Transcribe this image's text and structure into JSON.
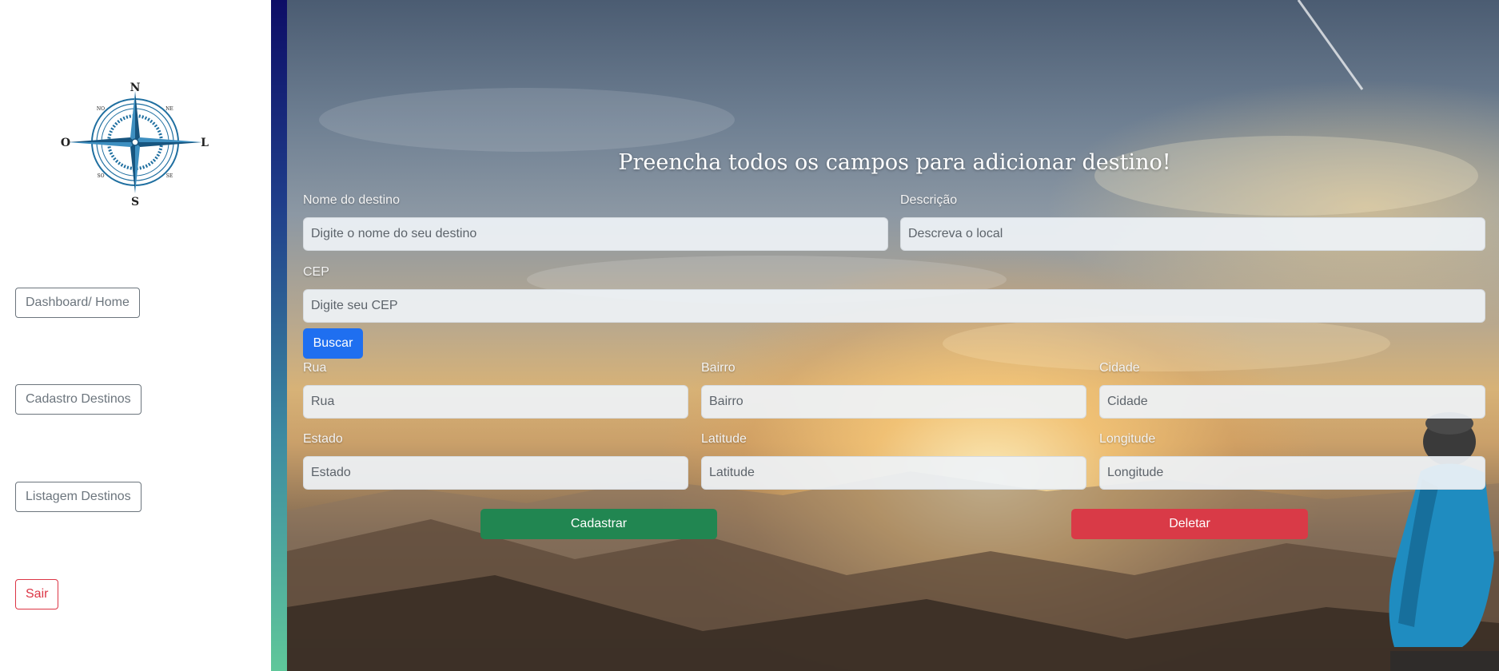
{
  "sidebar": {
    "logo": {
      "icon": "compass-rose-icon",
      "north": "N",
      "south": "S",
      "east": "L",
      "west": "O",
      "ne": "NE",
      "no": "NO",
      "se": "SE",
      "so": "SO"
    },
    "nav": {
      "dashboard": "Dashboard/ Home",
      "cadastro": "Cadastro Destinos",
      "listagem": "Listagem Destinos",
      "sair": "Sair"
    }
  },
  "form": {
    "title": "Preencha todos os campos para adicionar destino!",
    "nome": {
      "label": "Nome do destino",
      "placeholder": "Digite o nome do seu destino",
      "value": ""
    },
    "descricao": {
      "label": "Descrição",
      "placeholder": "Descreva o local",
      "value": ""
    },
    "cep": {
      "label": "CEP",
      "placeholder": "Digite seu CEP",
      "value": ""
    },
    "buscar_label": "Buscar",
    "rua": {
      "label": "Rua",
      "placeholder": "Rua",
      "value": ""
    },
    "bairro": {
      "label": "Bairro",
      "placeholder": "Bairro",
      "value": ""
    },
    "cidade": {
      "label": "Cidade",
      "placeholder": "Cidade",
      "value": ""
    },
    "estado": {
      "label": "Estado",
      "placeholder": "Estado",
      "value": ""
    },
    "latitude": {
      "label": "Latitude",
      "placeholder": "Latitude",
      "value": ""
    },
    "longitude": {
      "label": "Longitude",
      "placeholder": "Longitude",
      "value": ""
    },
    "cadastrar_label": "Cadastrar",
    "deletar_label": "Deletar"
  },
  "colors": {
    "primary": "#1f6ff0",
    "success": "#218651",
    "danger": "#d93a47",
    "sidebar_button": "#6c757d",
    "compass": "#1f6fa0"
  }
}
